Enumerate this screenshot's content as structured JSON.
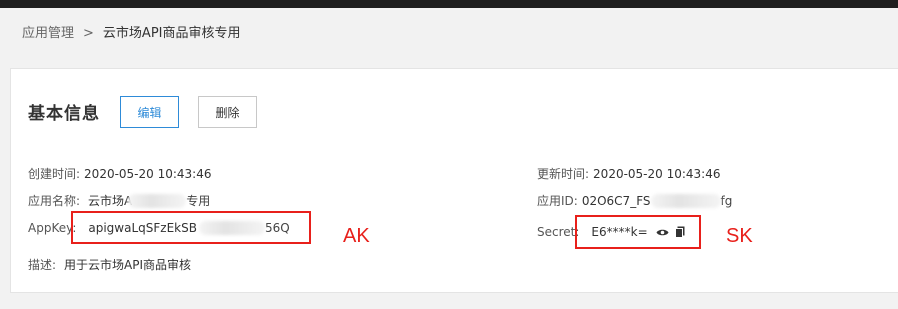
{
  "breadcrumb": {
    "parent": "应用管理",
    "separator": ">",
    "current": "云市场API商品审核专用"
  },
  "card": {
    "title": "基本信息",
    "edit_label": "编辑",
    "delete_label": "删除"
  },
  "left": {
    "created_label": "创建时间:",
    "created_value": "2020-05-20 10:43:46",
    "name_label": "应用名称:",
    "name_value_prefix": "云市场A",
    "name_value_suffix": "专用",
    "appkey_label": "AppKey:",
    "appkey_prefix": "apigwaLqSFzEkSB",
    "appkey_suffix": "56Q",
    "desc_label": "描述:",
    "desc_value": "用于云市场API商品审核"
  },
  "right": {
    "updated_label": "更新时间:",
    "updated_value": "2020-05-20 10:43:46",
    "appid_label": "应用ID:",
    "appid_prefix": "02O6C7_FS",
    "appid_suffix": "fg",
    "secret_label": "Secret:",
    "secret_value": "E6****k="
  },
  "annotations": {
    "ak": "AK",
    "sk": "SK"
  },
  "colors": {
    "accent": "#2e8bd8",
    "annotation_red": "#e8201b",
    "topbar": "#1f1f1f"
  },
  "icons": [
    "eye-icon",
    "copy-icon"
  ]
}
